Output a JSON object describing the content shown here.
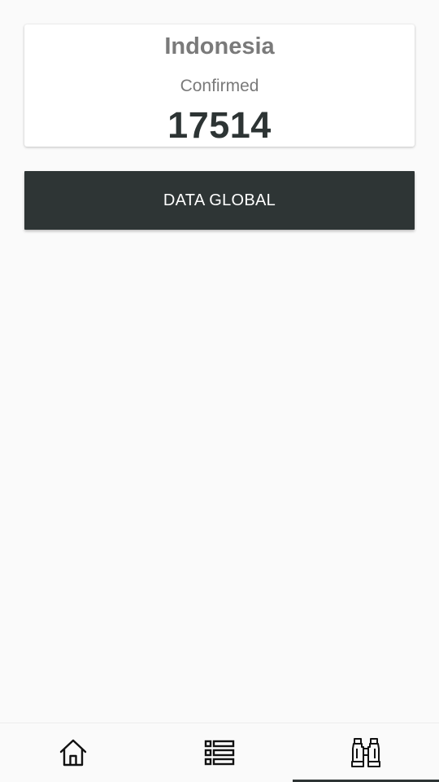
{
  "card": {
    "country": "Indonesia",
    "label": "Confirmed",
    "value": "17514"
  },
  "global_button": {
    "label": "DATA GLOBAL"
  },
  "bottom_nav": {
    "items": [
      {
        "icon": "home-icon",
        "active": false
      },
      {
        "icon": "list-icon",
        "active": false
      },
      {
        "icon": "binoculars-icon",
        "active": true
      }
    ]
  },
  "colors": {
    "background": "#fafafa",
    "card": "#ffffff",
    "button": "#2e3535",
    "value_text": "#2d3434",
    "muted_text": "#7a7a7a"
  }
}
